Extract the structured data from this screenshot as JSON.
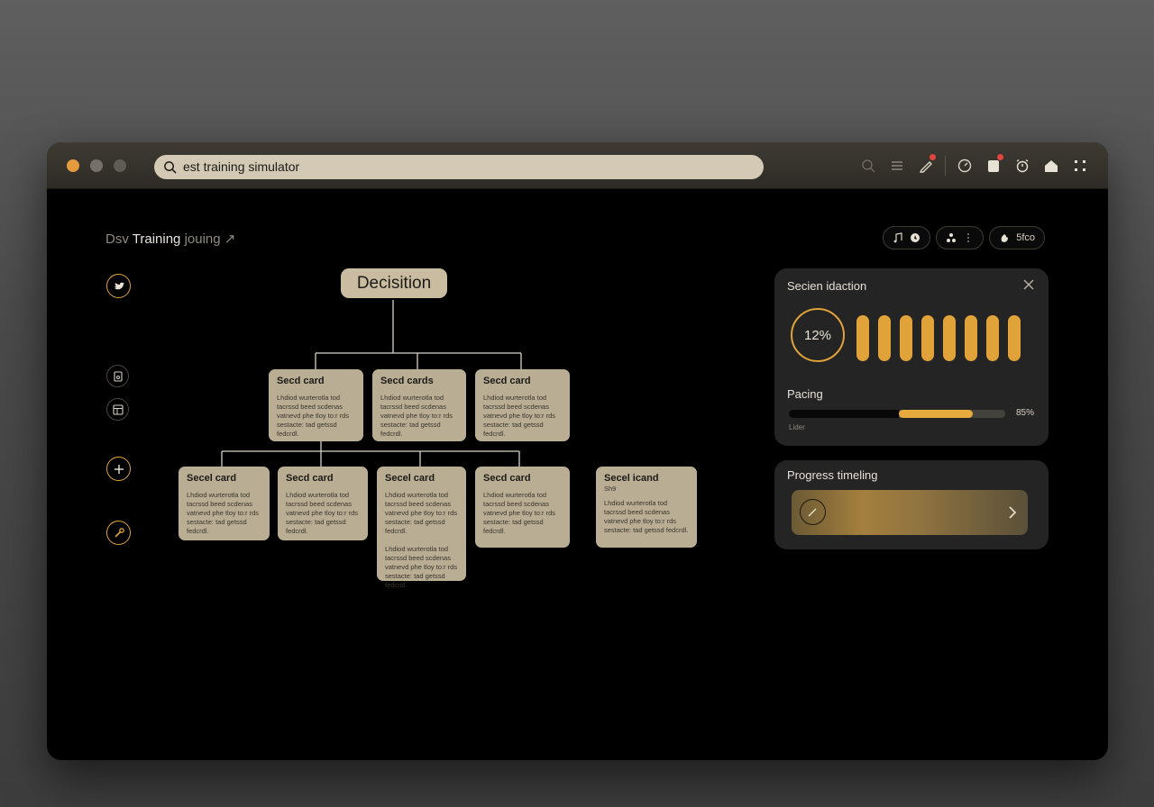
{
  "browser": {
    "url": "est training simulator"
  },
  "header": {
    "breadcrumb_prefix": "Dsv",
    "breadcrumb_title": "Training",
    "breadcrumb_suffix": "jouing",
    "pill_3_label": "5fco"
  },
  "tree": {
    "root_label": "Decisition",
    "row1": [
      {
        "title": "Secd card",
        "body": "Lhdiod wurterotla tod tacrssd beed scdenas vatnevd phe tloy to:r rds sestacte: tad getssd fedcrdl."
      },
      {
        "title": "Secd cards",
        "body": "Lhdiod wurterotla tod tacrssd beed scdenas vatnevd phe tloy to:r rds sestacte: tad getssd fedcrdl."
      },
      {
        "title": "Secd card",
        "body": "Lhdiod wurterotla tod tacrssd beed scdenas vatnevd phe tloy to:r rds sestacte: tad getssd fedcrdl."
      }
    ],
    "row2": [
      {
        "title": "Secel card",
        "body": "Lhdiod wurterotla tod tacrssd beed scdenas vatnevd phe tloy to:r rds sestacte: tad getssd fedcrdl."
      },
      {
        "title": "Secd card",
        "body": "Lhdiod wurterotla tod tacrssd beed scdenas vatnevd phe tloy to:r rds sestacte: tad getssd fedcrdl."
      },
      {
        "title": "Secel card",
        "body": "Lhdiod wurterotla tod tacrssd beed scdenas vatnevd phe tloy to:r rds sestacte: tad getssd fedcrdl.",
        "extra": "Lhdiod wurterotla tod tacrssd beed scdenas vatnevd phe tloy to:r rds sestacte: tad getssd fedcrdl."
      },
      {
        "title": "Secd card",
        "body": "Lhdiod wurterotla tod tacrssd beed scdenas vatnevd phe tloy to:r rds sestacte: tad getssd fedcrdl."
      },
      {
        "title": "Secel icand",
        "subtitle": "Sh9",
        "body": "Lhdiod wurterotla tod tacrssd beed scdenas vatnevd phe tloy to:r rds sestacte: tad getssd fedcrdl."
      }
    ]
  },
  "selection_panel": {
    "title": "Secien idaction",
    "ring_value": "12%",
    "pacing_label": "Pacing",
    "pacing_value": "85%",
    "pacing_fraction": 0.85,
    "pacing_sub_label": "Lider"
  },
  "timeline_panel": {
    "title": "Progress timeling"
  },
  "colors": {
    "accent": "#e0a33a",
    "card": "#b9ad94",
    "panel": "#242424"
  }
}
